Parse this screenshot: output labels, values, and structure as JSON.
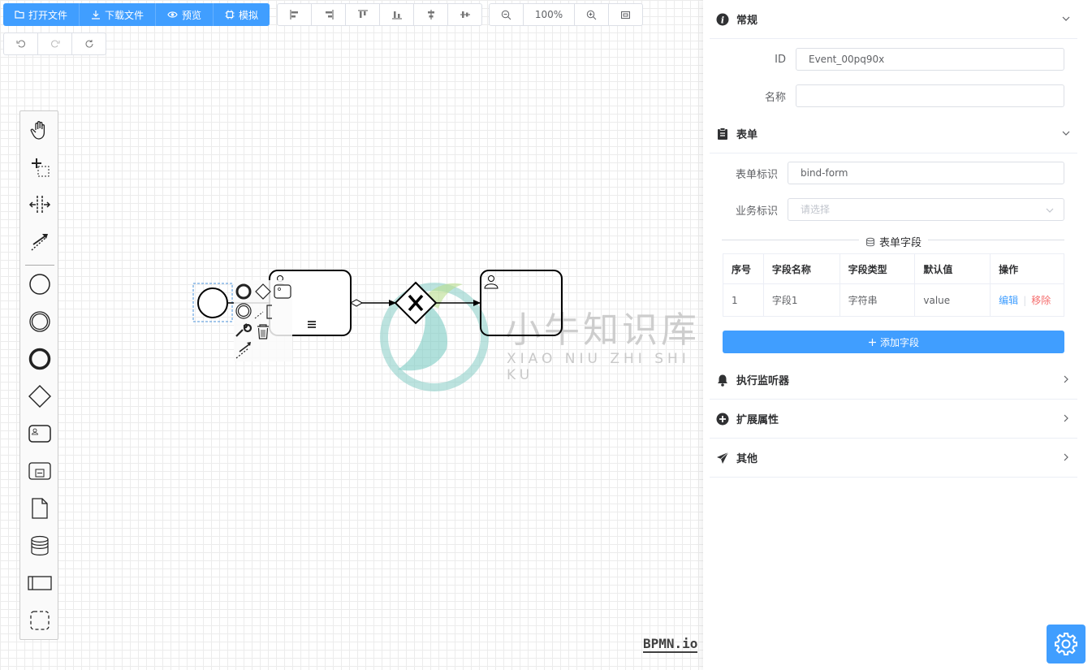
{
  "toolbar": {
    "open_file": "打开文件",
    "download_file": "下载文件",
    "preview": "预览",
    "simulate": "模拟",
    "zoom": "100%"
  },
  "watermark": {
    "title": "小牛知识库",
    "subtitle": "XIAO NIU ZHI SHI KU"
  },
  "logo": "BPMN.io",
  "panel": {
    "general": {
      "title": "常规",
      "id_label": "ID",
      "id_value": "Event_00pq90x",
      "name_label": "名称",
      "name_value": ""
    },
    "form": {
      "title": "表单",
      "key_label": "表单标识",
      "key_value": "bind-form",
      "biz_label": "业务标识",
      "biz_placeholder": "请选择",
      "fields_title": "表单字段",
      "columns": [
        "序号",
        "字段名称",
        "字段类型",
        "默认值",
        "操作"
      ],
      "rows": [
        {
          "index": "1",
          "name": "字段1",
          "type": "字符串",
          "default": "value",
          "edit": "编辑",
          "remove": "移除"
        }
      ],
      "add_field": "添加字段"
    },
    "listeners": {
      "title": "执行监听器"
    },
    "extensions": {
      "title": "扩展属性"
    },
    "others": {
      "title": "其他"
    }
  },
  "colors": {
    "primary": "#409eff",
    "danger": "#f56c6c"
  }
}
